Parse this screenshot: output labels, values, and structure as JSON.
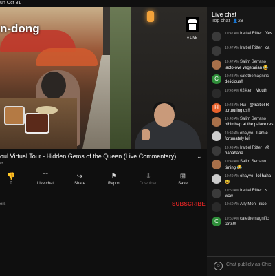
{
  "status_bar": {
    "time": "un Oct 31"
  },
  "video": {
    "overlay_title": "n-dong",
    "badge_live": "LIVE",
    "progress": 0.99
  },
  "title": "oul Virtual Tour - Hidden Gems of the Queen (Live Commentary)",
  "meta_line": "ch",
  "actions": [
    {
      "icon": "thumbs-down-icon",
      "glyph": "👎",
      "label": "0",
      "enabled": true
    },
    {
      "icon": "chat-icon",
      "glyph": "☷",
      "label": "Live chat",
      "enabled": true
    },
    {
      "icon": "share-icon",
      "glyph": "↪",
      "label": "Share",
      "enabled": true
    },
    {
      "icon": "flag-icon",
      "glyph": "⚑",
      "label": "Report",
      "enabled": true
    },
    {
      "icon": "download-icon",
      "glyph": "⬇",
      "label": "Download",
      "enabled": false
    },
    {
      "icon": "save-icon",
      "glyph": "⊞",
      "label": "Save",
      "enabled": true
    }
  ],
  "subscribers": "ers",
  "subscribe_label": "SUBSCRIBE",
  "chat": {
    "title": "Live chat",
    "subtitle": "Top chat",
    "viewer_count": "28",
    "input_placeholder": "Chat publicly as Chic",
    "messages": [
      {
        "time": "10:47 AM",
        "author": "Iraitiel Ritter",
        "extra": "Yes",
        "text": "",
        "avatar_letter": "",
        "avatar_color": "#3a3a3a"
      },
      {
        "time": "10:47 AM",
        "author": "Iraitiel Ritter",
        "extra": "ca",
        "text": "",
        "avatar_letter": "",
        "avatar_color": "#3a3a3a"
      },
      {
        "time": "10:47 AM",
        "author": "Salim Serrano",
        "extra": "",
        "text": "lacto-ove vegetarian 😂",
        "avatar_letter": "",
        "avatar_color": "#a8704a"
      },
      {
        "time": "10:48 AM",
        "author": "catethemagnific",
        "extra": "",
        "text": "delicious!!",
        "avatar_letter": "C",
        "avatar_color": "#2f8f3a"
      },
      {
        "time": "10:48 AM",
        "author": "024ten",
        "extra": "Mouth",
        "text": "",
        "avatar_letter": "",
        "avatar_color": "#2a2a2a"
      },
      {
        "time": "10:48 AM",
        "author": "Hui",
        "extra": "@Iraitiel R",
        "text": "tortuuring us!!",
        "avatar_letter": "H",
        "avatar_color": "#e8622c"
      },
      {
        "time": "10:48 AM",
        "author": "Salim Serrano",
        "extra": "",
        "text": "bibimbap at the palace res",
        "avatar_letter": "",
        "avatar_color": "#a8704a"
      },
      {
        "time": "10:49 AM",
        "author": "ohayyo",
        "extra": "I am e",
        "text": "fortunately lol",
        "avatar_letter": "",
        "avatar_color": "#cccccc"
      },
      {
        "time": "10:49 AM",
        "author": "Iraitiel Ritter",
        "extra": "@",
        "text": "hahahaha",
        "avatar_letter": "",
        "avatar_color": "#3a3a3a"
      },
      {
        "time": "10:49 AM",
        "author": "Salim Serrano",
        "extra": "",
        "text": "timing 😂",
        "avatar_letter": "",
        "avatar_color": "#a8704a"
      },
      {
        "time": "10:49 AM",
        "author": "ohayyo",
        "extra": "lol haha",
        "text": "😂",
        "avatar_letter": "",
        "avatar_color": "#cccccc"
      },
      {
        "time": "10:50 AM",
        "author": "Iraitiel Ritter",
        "extra": "s",
        "text": "wow",
        "avatar_letter": "",
        "avatar_color": "#3a3a3a"
      },
      {
        "time": "10:50 AM",
        "author": "Ally Mon",
        "extra": "ikse",
        "text": "",
        "avatar_letter": "",
        "avatar_color": "#2a2a2a"
      },
      {
        "time": "10:50 AM",
        "author": "catethemagnific",
        "extra": "",
        "text": "tarts!!!",
        "avatar_letter": "C",
        "avatar_color": "#2f8f3a"
      }
    ]
  },
  "colors": {
    "accent": "#ff0000",
    "subscribe": "#cc2222",
    "background": "#0f0f0f",
    "chat_bg": "#161616"
  }
}
